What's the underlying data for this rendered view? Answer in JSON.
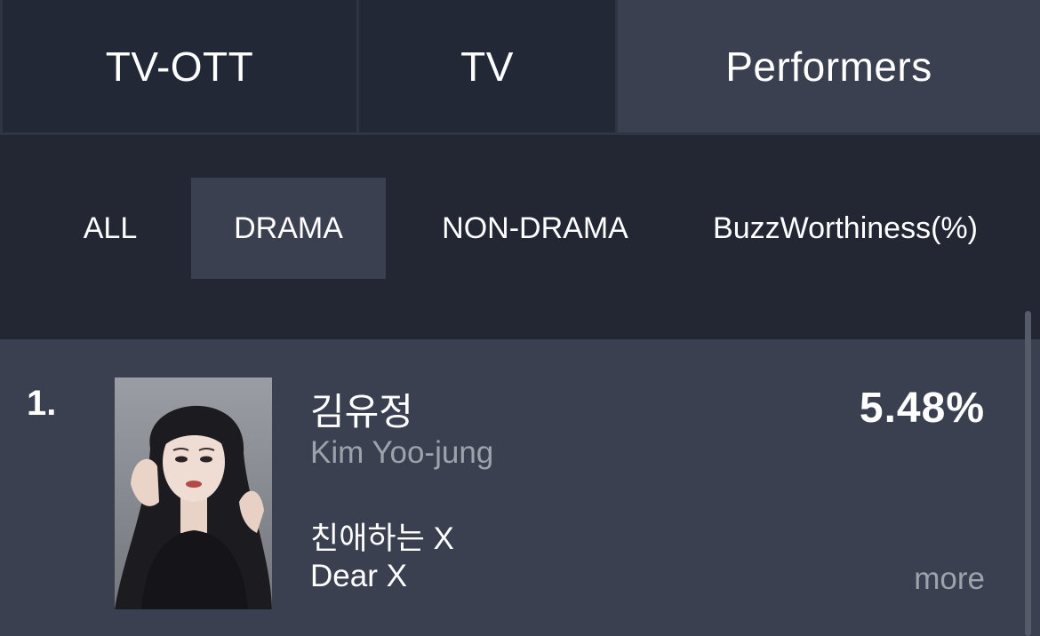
{
  "top_tabs": [
    {
      "label": "TV-OTT",
      "active": false
    },
    {
      "label": "TV",
      "active": false
    },
    {
      "label": "Performers",
      "active": true
    }
  ],
  "sub_tabs": [
    {
      "label": "ALL",
      "active": false
    },
    {
      "label": "DRAMA",
      "active": true
    },
    {
      "label": "NON-DRAMA",
      "active": false
    },
    {
      "label": "BuzzWorthiness(%)",
      "active": false
    }
  ],
  "rankings": [
    {
      "rank": "1.",
      "name_ko": "김유정",
      "name_en": "Kim Yoo-jung",
      "show_ko": "친애하는 X",
      "show_en": "Dear X",
      "percent": "5.48%",
      "more_label": "more"
    }
  ],
  "colors": {
    "background": "#222733",
    "active_tab": "#3b4050",
    "card": "#3b4050",
    "muted_text": "#9ea2ab",
    "text": "#ffffff"
  }
}
